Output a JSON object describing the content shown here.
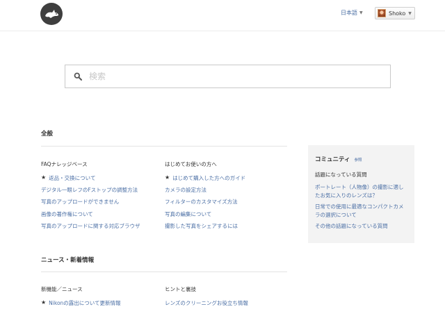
{
  "header": {
    "language": "日本語",
    "user_name": "Shoko"
  },
  "search": {
    "placeholder": "検索"
  },
  "sections": [
    {
      "title": "全般",
      "columns": [
        {
          "title": "FAQナレッジベース",
          "items": [
            {
              "label": "返品・交換について",
              "starred": true
            },
            {
              "label": "デジタル一眼レフのFストップの調整方法",
              "starred": false
            },
            {
              "label": "写真のアップロードができません",
              "starred": false
            },
            {
              "label": "画像の著作権について",
              "starred": false
            },
            {
              "label": "写真のアップロードに関する対応ブラウザ",
              "starred": false
            }
          ]
        },
        {
          "title": "はじめてお使いの方へ",
          "items": [
            {
              "label": "はじめて購入した方へのガイド",
              "starred": true
            },
            {
              "label": "カメラの設定方法",
              "starred": false
            },
            {
              "label": "フィルターのカスタマイズ方法",
              "starred": false
            },
            {
              "label": "写真の編集について",
              "starred": false
            },
            {
              "label": "撮影した写真をシェアするには",
              "starred": false
            }
          ]
        }
      ]
    },
    {
      "title": "ニュース・新着情報",
      "columns": [
        {
          "title": "新機能／ニュース",
          "items": [
            {
              "label": "Nikonの露出について更新情報",
              "starred": true
            }
          ]
        },
        {
          "title": "ヒントと裏技",
          "items": [
            {
              "label": "レンズのクリーニングお役立ち情報",
              "starred": false
            }
          ]
        }
      ]
    }
  ],
  "sidebar": {
    "title": "コミュニティ",
    "ref_link": "参照",
    "subtitle": "話題になっている質問",
    "links": [
      "ポートレート（人物像）の撮影に適したお気に入りのレンズは？",
      "日常での使用に最適なコンパクトカメラの選択について",
      "その他の話題になっている質問"
    ]
  },
  "colors": {
    "link": "#4b6fa5",
    "logo_bg": "#3f3f3f",
    "sidebar_bg": "#f3f3f3"
  },
  "icons": {
    "logo": "rabbit-logo-icon",
    "search": "search-icon",
    "dropdown": "caret-down-icon",
    "star": "star-icon"
  }
}
